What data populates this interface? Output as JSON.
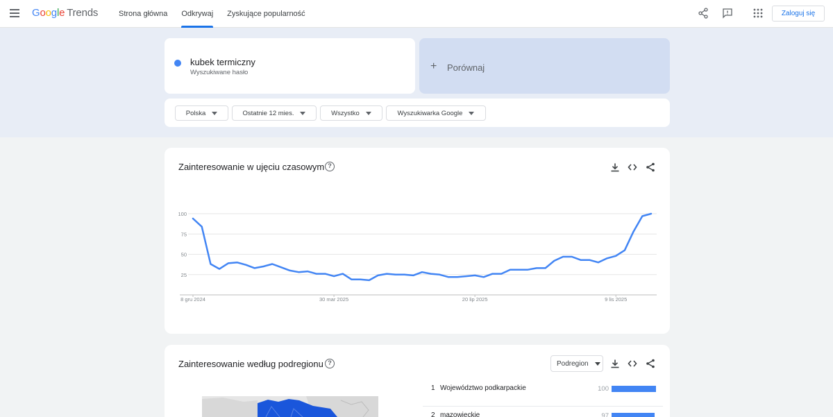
{
  "header": {
    "logo": [
      "G",
      "o",
      "o",
      "g",
      "l",
      "e"
    ],
    "logo_suffix": "Trends",
    "nav": [
      {
        "label": "Strona główna",
        "active": false
      },
      {
        "label": "Odkrywaj",
        "active": true
      },
      {
        "label": "Zyskujące popularność",
        "active": false
      }
    ],
    "login_label": "Zaloguj się",
    "icons": [
      "menu-icon",
      "share-icon",
      "feedback-icon",
      "apps-icon"
    ]
  },
  "search": {
    "term": "kubek termiczny",
    "term_sub": "Wyszukiwane hasło",
    "term_color": "#4285f4",
    "compare_label": "Porównaj"
  },
  "filters": [
    {
      "label": "Polska"
    },
    {
      "label": "Ostatnie 12 mies."
    },
    {
      "label": "Wszystko"
    },
    {
      "label": "Wyszukiwarka Google"
    }
  ],
  "timeline_card": {
    "title": "Zainteresowanie w ujęciu czasowym",
    "icons": [
      "help-icon",
      "download-icon",
      "embed-icon",
      "share-icon"
    ]
  },
  "chart_data": {
    "type": "line",
    "yticks": [
      "100",
      "75",
      "50",
      "25"
    ],
    "ylim": [
      0,
      100
    ],
    "xtick_labels": [
      "8 gru 2024",
      "30 mar 2025",
      "20 lip 2025",
      "9 lis 2025"
    ],
    "xtick_index": [
      0,
      16,
      32,
      48
    ],
    "grid": true,
    "series": [
      {
        "color": "#4285f4",
        "values": [
          94,
          84,
          38,
          32,
          39,
          40,
          37,
          33,
          35,
          38,
          34,
          30,
          28,
          29,
          26,
          26,
          23,
          26,
          19,
          19,
          18,
          24,
          26,
          25,
          25,
          24,
          28,
          26,
          25,
          22,
          22,
          23,
          24,
          22,
          26,
          26,
          31,
          31,
          31,
          33,
          33,
          42,
          47,
          47,
          43,
          43,
          40,
          45,
          48,
          55,
          78,
          97,
          100
        ]
      }
    ]
  },
  "region_card": {
    "title": "Zainteresowanie według podregionu",
    "select_label": "Podregion",
    "icons": [
      "help-icon",
      "download-icon",
      "embed-icon",
      "share-icon"
    ],
    "rows": [
      {
        "rank": "1",
        "name": "Województwo podkarpackie",
        "value": "100",
        "fraction": 1.0
      },
      {
        "rank": "2",
        "name": "mazowieckie",
        "value": "97",
        "fraction": 0.97
      }
    ]
  }
}
